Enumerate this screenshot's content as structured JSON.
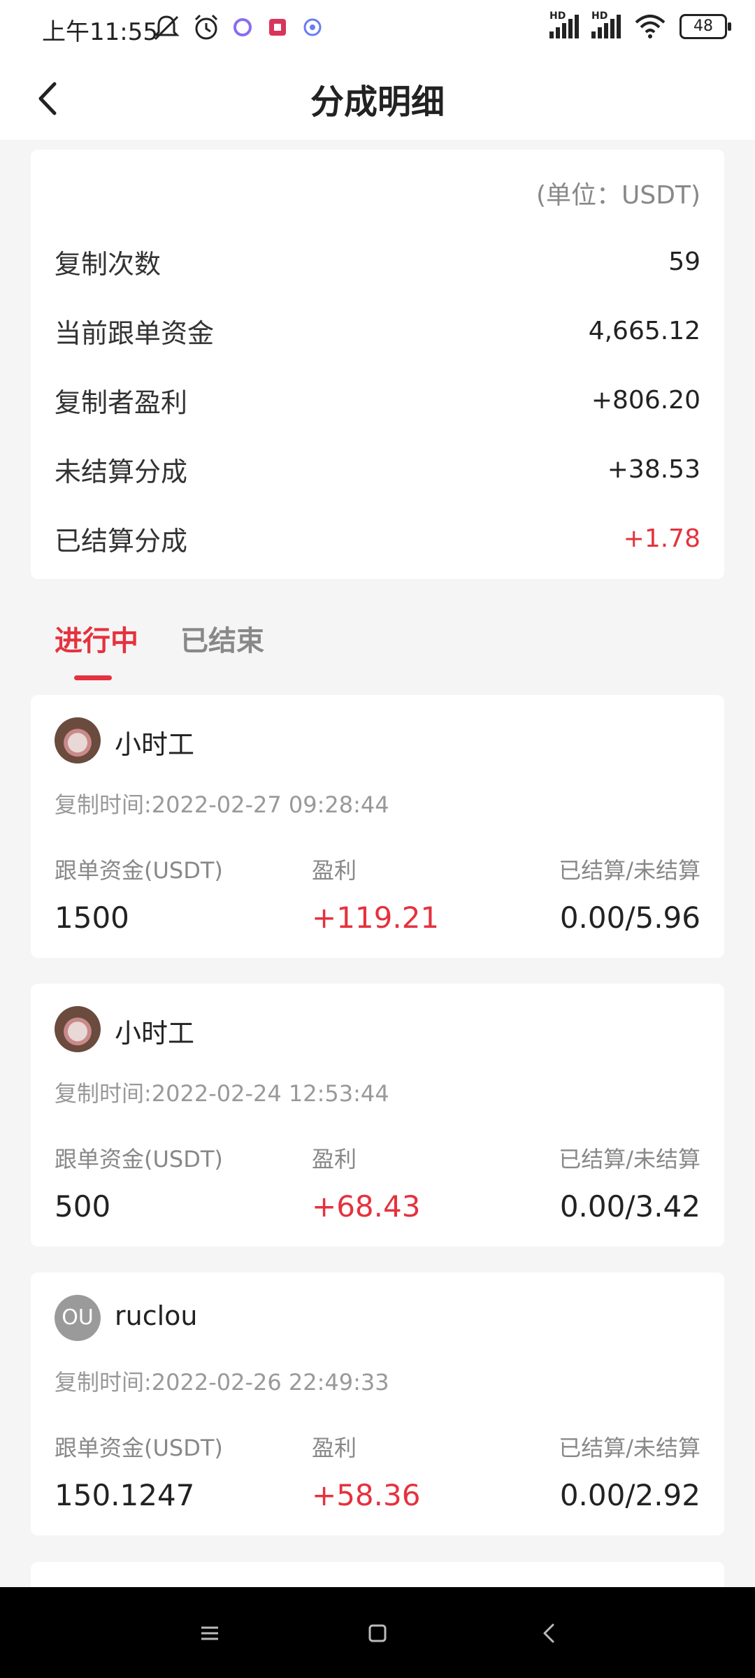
{
  "status_bar": {
    "time": "上午11:55",
    "hd1": "HD",
    "hd2": "HD",
    "battery": "48"
  },
  "header": {
    "title": "分成明细"
  },
  "summary": {
    "unit": "(单位：USDT)",
    "rows": [
      {
        "label": "复制次数",
        "value": "59"
      },
      {
        "label": "当前跟单资金",
        "value": "4,665.12"
      },
      {
        "label": "复制者盈利",
        "value": "+806.20"
      },
      {
        "label": "未结算分成",
        "value": "+38.53"
      },
      {
        "label": "已结算分成",
        "value": "+1.78"
      }
    ]
  },
  "tabs": [
    {
      "label": "进行中"
    },
    {
      "label": "已结束"
    }
  ],
  "records": [
    {
      "name": "小时工",
      "copy_time": "复制时间:2022-02-27 09:28:44",
      "col1_header": "跟单资金(USDT)",
      "col2_header": "盈利",
      "col3_header": "已结算/未结算",
      "amount": "1500",
      "profit": "+119.21",
      "settled": "0.00/5.96"
    },
    {
      "name": "小时工",
      "copy_time": "复制时间:2022-02-24 12:53:44",
      "col1_header": "跟单资金(USDT)",
      "col2_header": "盈利",
      "col3_header": "已结算/未结算",
      "amount": "500",
      "profit": "+68.43",
      "settled": "0.00/3.42"
    },
    {
      "name": "ruclou",
      "avatar_text": "OU",
      "copy_time": "复制时间:2022-02-26 22:49:33",
      "col1_header": "跟单资金(USDT)",
      "col2_header": "盈利",
      "col3_header": "已结算/未结算",
      "amount": "150.1247",
      "profit": "+58.36",
      "settled": "0.00/2.92"
    }
  ],
  "colors": {
    "accent_red": "#e5323e",
    "muted": "#888888",
    "page_bg": "#f5f5f5"
  }
}
